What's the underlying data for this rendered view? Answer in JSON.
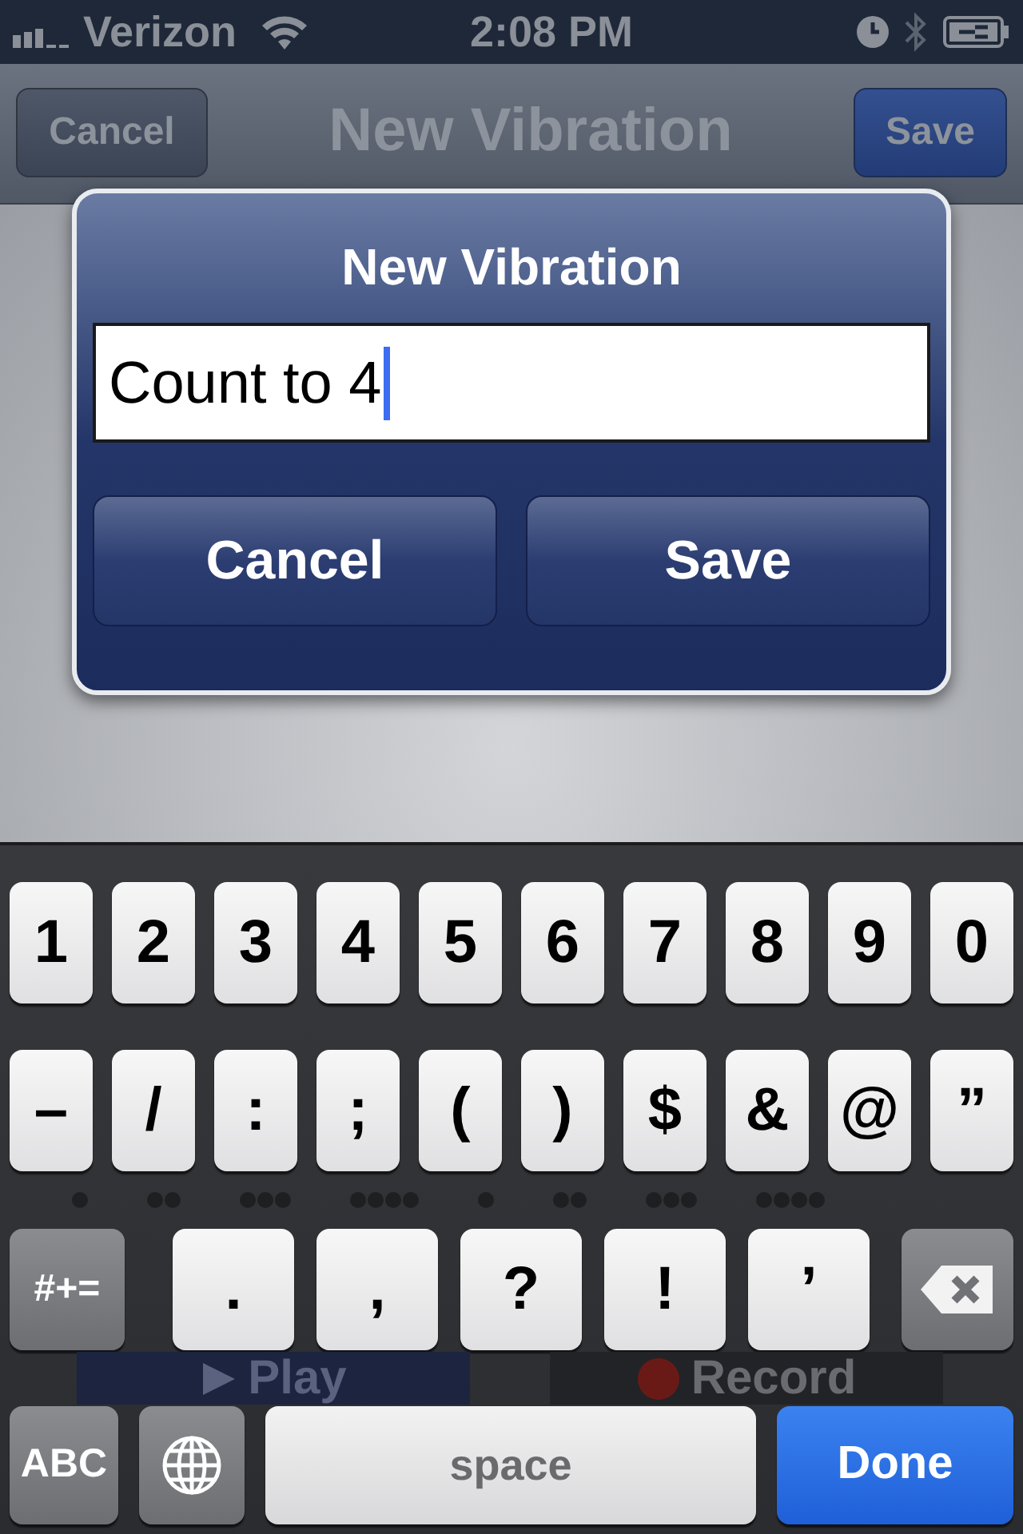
{
  "status_bar": {
    "carrier": "Verizon",
    "time": "2:08 PM"
  },
  "nav_bar": {
    "title": "New Vibration",
    "left_button": "Cancel",
    "right_button": "Save"
  },
  "alert": {
    "title": "New Vibration",
    "field_value": "Count to 4",
    "buttons": [
      "Cancel",
      "Save"
    ]
  },
  "behind_keyboard": {
    "play_button": "Play",
    "record_button": "Record"
  },
  "keyboard": {
    "number_row": [
      {
        "label": "1",
        "kind": "char"
      },
      {
        "label": "2",
        "kind": "char"
      },
      {
        "label": "3",
        "kind": "char"
      },
      {
        "label": "4",
        "kind": "char"
      },
      {
        "label": "5",
        "kind": "char"
      },
      {
        "label": "6",
        "kind": "char"
      },
      {
        "label": "7",
        "kind": "char"
      },
      {
        "label": "8",
        "kind": "char"
      },
      {
        "label": "9",
        "kind": "char"
      },
      {
        "label": "0",
        "kind": "char"
      }
    ],
    "symbol_row": [
      {
        "label": "–",
        "kind": "char"
      },
      {
        "label": "/",
        "kind": "char"
      },
      {
        "label": ":",
        "kind": "char"
      },
      {
        "label": ";",
        "kind": "char"
      },
      {
        "label": "(",
        "kind": "char"
      },
      {
        "label": ")",
        "kind": "char"
      },
      {
        "label": "$",
        "kind": "char"
      },
      {
        "label": "&",
        "kind": "char"
      },
      {
        "label": "@",
        "kind": "char"
      },
      {
        "label": "”",
        "kind": "char"
      }
    ],
    "punctuation_row": [
      {
        "label": "#+=",
        "kind": "shift"
      },
      {
        "label": ".",
        "kind": "wide"
      },
      {
        "label": ",",
        "kind": "wide"
      },
      {
        "label": "?",
        "kind": "wide"
      },
      {
        "label": "!",
        "kind": "wide"
      },
      {
        "label": "’",
        "kind": "wide"
      },
      {
        "kind": "delete"
      }
    ],
    "bottom_row": [
      {
        "label": "ABC",
        "kind": "mode"
      },
      {
        "kind": "globe"
      },
      {
        "label": "space",
        "kind": "space"
      },
      {
        "label": "Done",
        "kind": "done"
      }
    ]
  }
}
